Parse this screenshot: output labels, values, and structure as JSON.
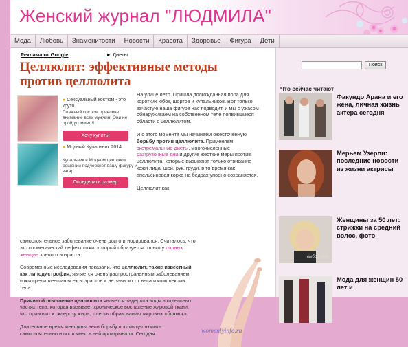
{
  "site": {
    "title": "Женский журнал \"ЛЮДМИЛА\""
  },
  "nav": [
    "Мода",
    "Любовь",
    "Знаменитости",
    "Новости",
    "Красота",
    "Здоровье",
    "Фигура",
    "Дети"
  ],
  "ads": {
    "google": "Реклама от Google",
    "link": "► Диеты"
  },
  "article": {
    "title": "Целлюлит: эффективные методы против целлюлита",
    "p1": "На улице лето. Пришла долгожданная пора для коротких юбок, шортов и купальников. Вот только зачастую наша фигура нас подводит, и мы с ужасом обнаруживаем на собственном теле появившиеся области с целлюлитом.",
    "p2_a": "И с этого момента мы начинаем ожесточенную ",
    "p2_b": "борьбу против целлюлита.",
    "p2_c": " Применяем ",
    "p2_link1": "экстремальные диеты",
    "p2_d": ", многочисленные ",
    "p2_link2": "разгрузочные дни",
    "p2_e": " и другие жесткие меры против целлюлита, которые вызывают только отвисание кожи лица, шеи, рук, груди, в то время как апельсиновая корка на бедрах упорно сохраняется.",
    "p3_a": "Целлюлит как",
    "p3_b": "самостоятельное заболевание очень долго игнорировался. Считалось, что это косметический дефект кожи, который образуется только у ",
    "p3_link": "полных женщин",
    "p3_c": " зрелого возраста.",
    "p4_a": "Современные исследования показали, что ",
    "p4_b": "целлюлит, также известный как липодистрофия,",
    "p4_c": " является очень распространенным заболеванием кожи среди женщин всех возрастов и не зависит от веса и комплекции тела.",
    "p5_a": "Причиной появление целлюлита",
    "p5_b": " является задержка воды в отдельных частях тела, которая вызывает хроническое воспаление жировой ткани, что приводит к склерозу жира, то есть образованию жировых «блямок».",
    "p6": "Длительное время женщины вели борьбу против целлюлита самостоятельно и постоянно в ней проигрывали. Сегодня",
    "image_caption": "womenlyinfo.ru"
  },
  "adbox": {
    "ad1_title": "Сексуальный костюм - это круто",
    "ad1_text": "Пляжный костюм привлечет внимание всех мужчин! Они не пройдут мимо!!",
    "ad1_button": "Хочу купить!",
    "ad2_title": "Модный Купальник 2014",
    "ad2_text": "Купальник в Модном цветовом решении подчеркнет вашу фигуру и загар.",
    "ad2_button": "Определить размер"
  },
  "sidebar": {
    "search_button": "Поиск",
    "heading": "Что сейчас читают",
    "items": [
      {
        "text": "Факундо Арана и его жена, личная жизнь актера сегодня"
      },
      {
        "text": "Мерьем Узерли: последние новости из жизни актрисы"
      },
      {
        "text": "Женщины за 50 лет: стрижки на средний волос, фото",
        "watermark": "выбор шоп"
      },
      {
        "text": "Мода для женщин 50 лет и"
      }
    ]
  },
  "colors": {
    "title": "#e0338e",
    "article_title": "#b8401e",
    "link": "#c23b8d",
    "page_bg": "#e5aad0",
    "sidebar_bg": "#f6eaf2",
    "button": "#e23a6a"
  }
}
